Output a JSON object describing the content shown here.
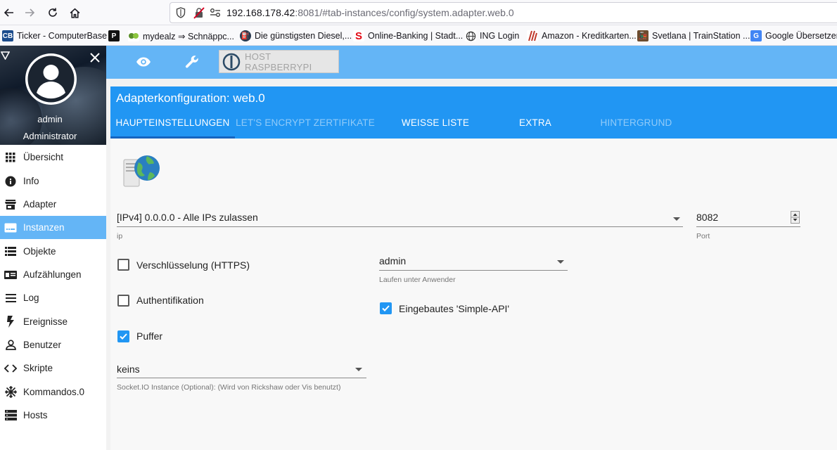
{
  "browser": {
    "url_host": "192.168.178.42",
    "url_rest": ":8081/#tab-instances/config/system.adapter.web.0",
    "bookmarks": [
      {
        "label": "Ticker - ComputerBase",
        "icon": "computerbase-icon",
        "color": "#1c4c8c"
      },
      {
        "label": "",
        "icon": "p-logo-icon",
        "color": "#111111"
      },
      {
        "label": "mydealz ⇒ Schnäppc...",
        "icon": "mydealz-icon",
        "color": "#5a8f2a"
      },
      {
        "label": "Die günstigsten Diesel,...",
        "icon": "fuel-icon",
        "color": "#2a3a4f"
      },
      {
        "label": "Online-Banking | Stadt...",
        "icon": "sparkasse-icon",
        "color": "#e30613"
      },
      {
        "label": "ING Login",
        "icon": "globe-icon",
        "color": "#333333"
      },
      {
        "label": "Amazon - Kreditkarten...",
        "icon": "amazon-card-icon",
        "color": "#c0392b"
      },
      {
        "label": "Svetlana | TrainStation ...",
        "icon": "trainstation-icon",
        "color": "#6d4c2f"
      },
      {
        "label": "Google Übersetzer",
        "icon": "google-translate-icon",
        "color": "#4285f4"
      }
    ]
  },
  "sidebar": {
    "user_name": "admin",
    "user_role": "Administrator",
    "items": [
      {
        "label": "Übersicht",
        "icon": "grid-icon",
        "active": false
      },
      {
        "label": "Info",
        "icon": "info-icon",
        "active": false
      },
      {
        "label": "Adapter",
        "icon": "store-icon",
        "active": false
      },
      {
        "label": "Instanzen",
        "icon": "instances-icon",
        "active": true
      },
      {
        "label": "Objekte",
        "icon": "list-icon",
        "active": false
      },
      {
        "label": "Aufzählungen",
        "icon": "enum-icon",
        "active": false
      },
      {
        "label": "Log",
        "icon": "log-icon",
        "active": false
      },
      {
        "label": "Ereignisse",
        "icon": "bolt-icon",
        "active": false
      },
      {
        "label": "Benutzer",
        "icon": "user-icon",
        "active": false
      },
      {
        "label": "Skripte",
        "icon": "code-icon",
        "active": false
      },
      {
        "label": "Kommandos.0",
        "icon": "snowflake-icon",
        "active": false
      },
      {
        "label": "Hosts",
        "icon": "hosts-icon",
        "active": false
      }
    ]
  },
  "appbar": {
    "host_label": "HOST RASPBERRYPI"
  },
  "panel": {
    "title": "Adapterkonfiguration: web.0",
    "tabs": [
      {
        "label": "HAUPTEINSTELLUNGEN",
        "state": "active"
      },
      {
        "label": "LET'S ENCRYPT ZERTIFIKATE",
        "state": "disabled"
      },
      {
        "label": "WEISSE LISTE",
        "state": "normal"
      },
      {
        "label": "EXTRA",
        "state": "normal"
      },
      {
        "label": "HINTERGRUND",
        "state": "disabled"
      }
    ]
  },
  "form": {
    "ip": {
      "value": "[IPv4] 0.0.0.0 - Alle IPs zulassen",
      "label": "ip"
    },
    "port": {
      "value": "8082",
      "label": "Port"
    },
    "https": {
      "label": "Verschlüsselung (HTTPS)",
      "checked": false
    },
    "auth": {
      "label": "Authentifikation",
      "checked": false
    },
    "buffer": {
      "label": "Puffer",
      "checked": true
    },
    "run_as": {
      "value": "admin",
      "label": "Laufen unter Anwender"
    },
    "simple_api": {
      "label": "Eingebautes 'Simple-API'",
      "checked": true
    },
    "socketio": {
      "value": "keins",
      "label": "Socket.IO Instance (Optional): (Wird von Rickshaw oder Vis benutzt)"
    }
  },
  "colors": {
    "accent": "#2196f3",
    "appbar": "#64b5f6",
    "active_nav": "#64b5f6"
  }
}
